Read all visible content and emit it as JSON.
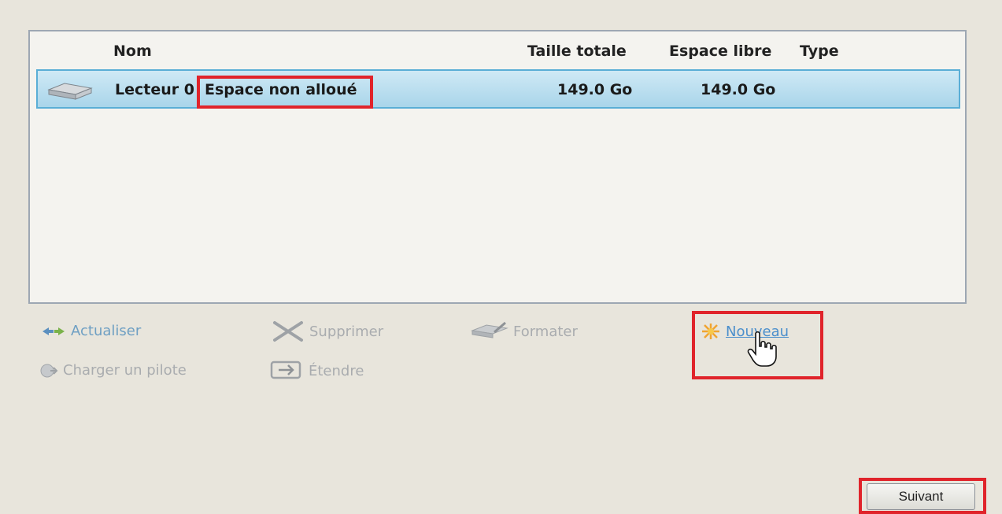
{
  "columns": {
    "name": "Nom",
    "total_size": "Taille totale",
    "free_space": "Espace libre",
    "type": "Type"
  },
  "rows": [
    {
      "icon": "hard-drive-icon",
      "drive": "Lecteur 0",
      "partition": "Espace non alloué",
      "total_size": "149.0 Go",
      "free_space": "149.0 Go",
      "type": ""
    }
  ],
  "actions": {
    "refresh": "Actualiser",
    "delete": "Supprimer",
    "format": "Formater",
    "new": "Nouveau",
    "load_driver": "Charger un pilote",
    "extend": "Étendre"
  },
  "next_button": "Suivant",
  "colors": {
    "highlight": "#e0242b",
    "selection": "#a9d5ea",
    "link": "#4b8fcc"
  }
}
